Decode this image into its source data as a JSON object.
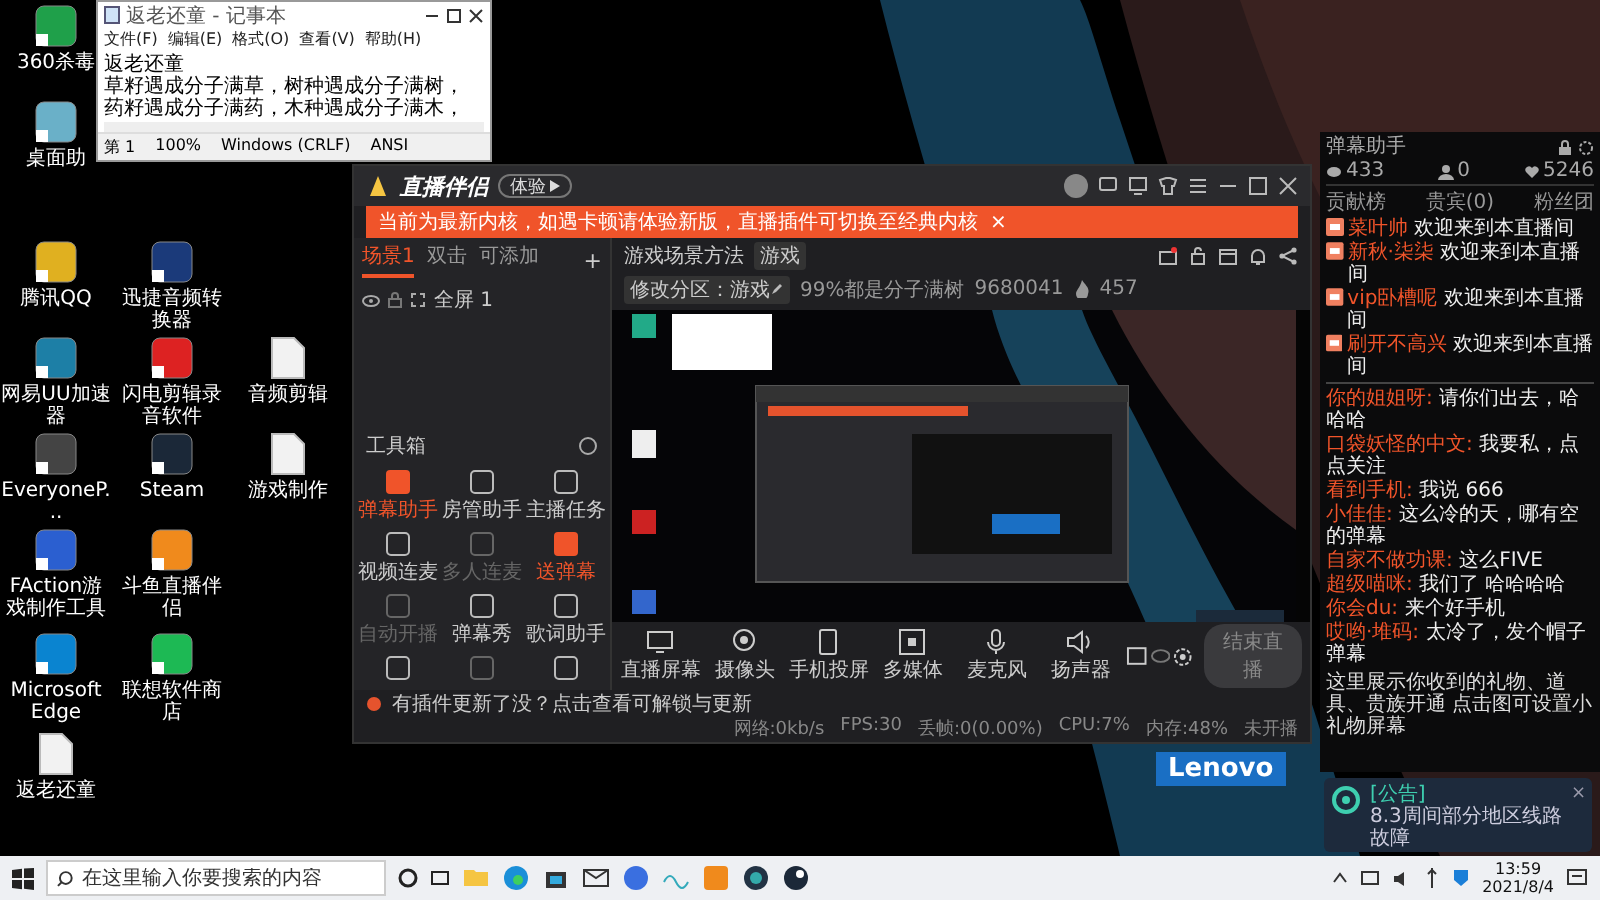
{
  "desktop_icons": [
    {
      "label": "360杀毒",
      "kind": "app"
    },
    {
      "label": "桌面助",
      "kind": "app"
    },
    {
      "label": "腾讯QQ",
      "kind": "app"
    },
    {
      "label": "迅捷音频转换器",
      "kind": "app"
    },
    {
      "label": "网易UU加速器",
      "kind": "app"
    },
    {
      "label": "闪电剪辑录音软件",
      "kind": "app"
    },
    {
      "label": "音频剪辑",
      "kind": "file"
    },
    {
      "label": "EveryoneP...",
      "kind": "app"
    },
    {
      "label": "Steam",
      "kind": "app"
    },
    {
      "label": "游戏制作",
      "kind": "file"
    },
    {
      "label": "FAction游戏制作工具",
      "kind": "app"
    },
    {
      "label": "斗鱼直播伴侣",
      "kind": "app"
    },
    {
      "label": "Microsoft Edge",
      "kind": "app"
    },
    {
      "label": "联想软件商店",
      "kind": "app"
    },
    {
      "label": "返老还童",
      "kind": "file"
    }
  ],
  "notepad": {
    "title": "返老还童 - 记事本",
    "menu": [
      "文件(F)",
      "编辑(E)",
      "格式(O)",
      "查看(V)",
      "帮助(H)"
    ],
    "lines": [
      "返老还童",
      "草籽遇成分子满草，树种遇成分子满树，",
      "药籽遇成分子满药，木种遇成分子满木，"
    ],
    "status": [
      "第 1",
      "100%",
      "Windows (CRLF)",
      "ANSI"
    ]
  },
  "app": {
    "name": "直播伴侣",
    "version_button": "体验",
    "banner": {
      "text": "当前为最新内核，如遇卡顿请体验新版，直播插件可切换至经典内核",
      "close": "×"
    },
    "scene_tabs": [
      {
        "label": "场景1",
        "selected": true
      },
      {
        "label": "双击",
        "selected": false
      },
      {
        "label": "可添加",
        "selected": false
      }
    ],
    "add_scene": "+",
    "sources": [
      {
        "label": "全屏 1"
      }
    ],
    "stream": {
      "title": "游戏场景方法",
      "tag": "游戏",
      "category_button": "修改分区：游戏",
      "room_name": "99%都是分子满树",
      "room_id": "9680041",
      "viewers": "457"
    },
    "toolbox": {
      "title": "工具箱",
      "tools": [
        {
          "label": "弹幕助手",
          "active": true,
          "disabled": false
        },
        {
          "label": "房管助手",
          "active": false,
          "disabled": false
        },
        {
          "label": "主播任务",
          "active": false,
          "disabled": false
        },
        {
          "label": "视频连麦",
          "active": false,
          "disabled": false
        },
        {
          "label": "多人连麦",
          "active": false,
          "disabled": true
        },
        {
          "label": "送弹幕",
          "active": true,
          "disabled": false
        },
        {
          "label": "自动开播",
          "active": false,
          "disabled": true
        },
        {
          "label": "弹幕秀",
          "active": false,
          "disabled": false
        },
        {
          "label": "歌词助手",
          "active": false,
          "disabled": false
        },
        {
          "active": false,
          "disabled": false
        },
        {
          "active": false,
          "disabled": true
        },
        {
          "active": false,
          "disabled": false
        }
      ]
    },
    "controls": [
      {
        "label": "直播屏幕"
      },
      {
        "label": "摄像头"
      },
      {
        "label": "手机投屏"
      },
      {
        "label": "多媒体"
      },
      {
        "label": "麦克风"
      },
      {
        "label": "扬声器"
      }
    ],
    "end_button": "结束直播",
    "notice": "有插件更新了没？点击查看可解锁与更新",
    "stats": [
      "网络:0kb/s",
      "FPS:30",
      "丢帧:0(0.00%)",
      "CPU:7%",
      "内存:48%",
      "未开播"
    ]
  },
  "wallpaper_logo": "Lenovo",
  "chat_panel": {
    "title": "弹幕助手",
    "stats": [
      "433",
      "0",
      "5246"
    ],
    "tabs": [
      "贡献榜",
      "贵宾(0)",
      "粉丝团"
    ],
    "welcomes": [
      {
        "name": "菜叶帅",
        "text": "欢迎来到本直播间"
      },
      {
        "name": "新秋·柒柒",
        "text": "欢迎来到本直播间"
      },
      {
        "name": "vip卧槽呢",
        "text": "欢迎来到本直播间"
      },
      {
        "name": "刷开不高兴",
        "text": "欢迎来到本直播间"
      }
    ],
    "messages": [
      {
        "name": "你的姐姐呀:",
        "text": "请你们出去，哈哈哈"
      },
      {
        "name": "口袋妖怪的中文:",
        "text": "我要私，点点关注"
      },
      {
        "name": "看到手机:",
        "text": "我说 666"
      },
      {
        "name": "小佳佳:",
        "text": "这么冷的天，哪有空的弹幕"
      },
      {
        "name": "自家不做功课:",
        "text": "这么FIVE"
      },
      {
        "name": "超级喵咪:",
        "text": "我们了 哈哈哈哈"
      },
      {
        "name": "你会du:",
        "text": "来个好手机"
      },
      {
        "name": "哎哟·堆码:",
        "text": "太冷了，发个帽子弹幕"
      }
    ],
    "footer": "这里展示你收到的礼物、道具、贵族开通 点击图可设置小礼物屏幕"
  },
  "toast": {
    "title": "[公告]",
    "text": "8.3周间部分地区线路故障",
    "close": "×"
  },
  "taskbar": {
    "search_placeholder": "在这里输入你要搜索的内容",
    "time": "13:59",
    "date": "2021/8/4"
  }
}
